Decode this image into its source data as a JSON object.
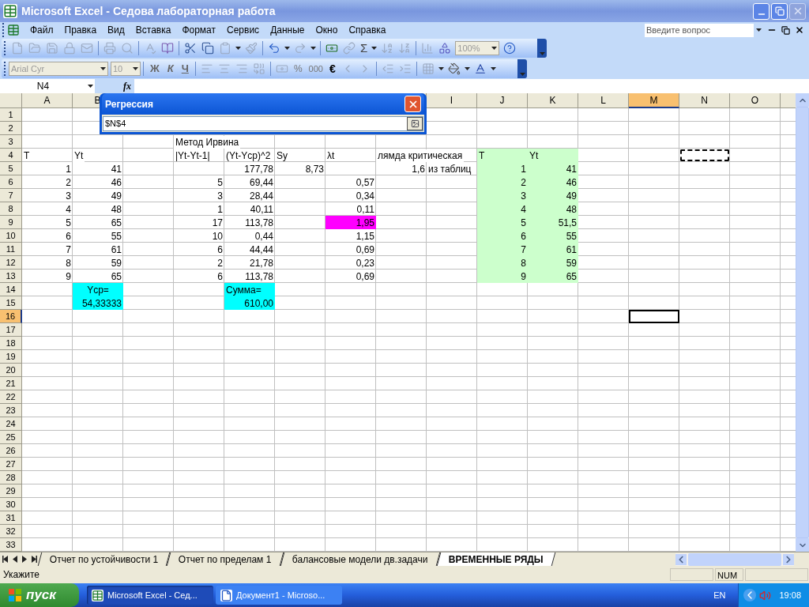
{
  "window": {
    "title": "Microsoft Excel - Седова лабораторная работа"
  },
  "menu": [
    "Файл",
    "Правка",
    "Вид",
    "Вставка",
    "Формат",
    "Сервис",
    "Данные",
    "Окно",
    "Справка"
  ],
  "help_search": {
    "placeholder": "Введите вопрос"
  },
  "standard_toolbar": {
    "sum": "Σ",
    "zoom": "100%"
  },
  "format_toolbar": {
    "font": "Arial Cyr",
    "size": "10",
    "bold": "Ж",
    "italic": "К",
    "underline": "Ч",
    "percent": "%",
    "thousands": "000",
    "euro": "€"
  },
  "formula_bar": {
    "name_box": "N4",
    "fx": "fx"
  },
  "dialog": {
    "title": "Регрессия",
    "value": "$N$4"
  },
  "column_headers": [
    {
      "label": "A",
      "selected": false
    },
    {
      "label": "B",
      "selected": false
    },
    {
      "label": "I",
      "selected": false
    },
    {
      "label": "J",
      "selected": false
    },
    {
      "label": "K",
      "selected": false
    },
    {
      "label": "L",
      "selected": false
    },
    {
      "label": "M",
      "selected": true
    },
    {
      "label": "N",
      "selected": false
    },
    {
      "label": "O",
      "selected": false
    }
  ],
  "rows": [
    {
      "header": "1",
      "selected": false
    },
    {
      "header": "2",
      "selected": false
    },
    {
      "header": "3",
      "selected": false,
      "cells": [
        null,
        null,
        null,
        {
          "text": "Метод Ирвина",
          "kind": "text",
          "selected": false
        }
      ]
    },
    {
      "header": "4",
      "selected": false,
      "cells": [
        {
          "text": "T",
          "kind": "text",
          "selected": false
        },
        {
          "text": "Yt",
          "kind": "text",
          "selected": false
        },
        null,
        {
          "text": "|Yt-Yt-1|",
          "kind": "text",
          "selected": false
        },
        {
          "text": "(Yt-Ycp)^2",
          "kind": "text",
          "selected": false
        },
        {
          "text": "Sy",
          "kind": "text",
          "selected": false
        },
        {
          "text": "λt",
          "kind": "text",
          "selected": false
        },
        {
          "text": "лямда критическая",
          "kind": "text",
          "selected": false
        },
        null,
        {
          "text": "T",
          "kind": "text",
          "selected": false,
          "color": "#ccffcc"
        },
        {
          "text": "Yt",
          "kind": "text",
          "selected": false,
          "color": "#ccffcc"
        },
        null,
        null,
        {
          "selected": false,
          "marquee": true
        }
      ]
    },
    {
      "header": "5",
      "selected": false,
      "cells": [
        {
          "text": "1",
          "kind": "number",
          "selected": false
        },
        {
          "text": "41",
          "kind": "number",
          "selected": false
        },
        null,
        null,
        {
          "text": "177,78",
          "kind": "number",
          "selected": false
        },
        {
          "text": "8,73",
          "kind": "number",
          "selected": false
        },
        null,
        {
          "text": "1,6",
          "kind": "number",
          "selected": false
        },
        {
          "text": "из таблиц",
          "kind": "text",
          "selected": false
        },
        {
          "text": "1",
          "kind": "number",
          "selected": false,
          "color": "#ccffcc"
        },
        {
          "text": "41",
          "kind": "number",
          "selected": false,
          "color": "#ccffcc"
        }
      ]
    },
    {
      "header": "6",
      "selected": false,
      "cells": [
        {
          "text": "2",
          "kind": "number",
          "selected": false
        },
        {
          "text": "46",
          "kind": "number",
          "selected": false
        },
        null,
        {
          "text": "5",
          "kind": "number",
          "selected": false
        },
        {
          "text": "69,44",
          "kind": "number",
          "selected": false
        },
        null,
        {
          "text": "0,57",
          "kind": "number",
          "selected": false
        },
        null,
        null,
        {
          "text": "2",
          "kind": "number",
          "selected": false,
          "color": "#ccffcc"
        },
        {
          "text": "46",
          "kind": "number",
          "selected": false,
          "color": "#ccffcc"
        }
      ]
    },
    {
      "header": "7",
      "selected": false,
      "cells": [
        {
          "text": "3",
          "kind": "number",
          "selected": false
        },
        {
          "text": "49",
          "kind": "number",
          "selected": false
        },
        null,
        {
          "text": "3",
          "kind": "number",
          "selected": false
        },
        {
          "text": "28,44",
          "kind": "number",
          "selected": false
        },
        null,
        {
          "text": "0,34",
          "kind": "number",
          "selected": false
        },
        null,
        null,
        {
          "text": "3",
          "kind": "number",
          "selected": false,
          "color": "#ccffcc"
        },
        {
          "text": "49",
          "kind": "number",
          "selected": false,
          "color": "#ccffcc"
        }
      ]
    },
    {
      "header": "8",
      "selected": false,
      "cells": [
        {
          "text": "4",
          "kind": "number",
          "selected": false
        },
        {
          "text": "48",
          "kind": "number",
          "selected": false
        },
        null,
        {
          "text": "1",
          "kind": "number",
          "selected": false
        },
        {
          "text": "40,11",
          "kind": "number",
          "selected": false
        },
        null,
        {
          "text": "0,11",
          "kind": "number",
          "selected": false
        },
        null,
        null,
        {
          "text": "4",
          "kind": "number",
          "selected": false,
          "color": "#ccffcc"
        },
        {
          "text": "48",
          "kind": "number",
          "selected": false,
          "color": "#ccffcc"
        }
      ]
    },
    {
      "header": "9",
      "selected": false,
      "cells": [
        {
          "text": "5",
          "kind": "number",
          "selected": false
        },
        {
          "text": "65",
          "kind": "number",
          "selected": false
        },
        null,
        {
          "text": "17",
          "kind": "number",
          "selected": false
        },
        {
          "text": "113,78",
          "kind": "number",
          "selected": false
        },
        null,
        {
          "text": "1,95",
          "kind": "number",
          "selected": false,
          "color": "#ff00ff"
        },
        null,
        null,
        {
          "text": "5",
          "kind": "number",
          "selected": false,
          "color": "#ccffcc"
        },
        {
          "text": "51,5",
          "kind": "number",
          "selected": false,
          "color": "#ccffcc"
        }
      ]
    },
    {
      "header": "10",
      "selected": false,
      "cells": [
        {
          "text": "6",
          "kind": "number",
          "selected": false
        },
        {
          "text": "55",
          "kind": "number",
          "selected": false
        },
        null,
        {
          "text": "10",
          "kind": "number",
          "selected": false
        },
        {
          "text": "0,44",
          "kind": "number",
          "selected": false
        },
        null,
        {
          "text": "1,15",
          "kind": "number",
          "selected": false
        },
        null,
        null,
        {
          "text": "6",
          "kind": "number",
          "selected": false,
          "color": "#ccffcc"
        },
        {
          "text": "55",
          "kind": "number",
          "selected": false,
          "color": "#ccffcc"
        }
      ]
    },
    {
      "header": "11",
      "selected": false,
      "cells": [
        {
          "text": "7",
          "kind": "number",
          "selected": false
        },
        {
          "text": "61",
          "kind": "number",
          "selected": false
        },
        null,
        {
          "text": "6",
          "kind": "number",
          "selected": false
        },
        {
          "text": "44,44",
          "kind": "number",
          "selected": false
        },
        null,
        {
          "text": "0,69",
          "kind": "number",
          "selected": false
        },
        null,
        null,
        {
          "text": "7",
          "kind": "number",
          "selected": false,
          "color": "#ccffcc"
        },
        {
          "text": "61",
          "kind": "number",
          "selected": false,
          "color": "#ccffcc"
        }
      ]
    },
    {
      "header": "12",
      "selected": false,
      "cells": [
        {
          "text": "8",
          "kind": "number",
          "selected": false
        },
        {
          "text": "59",
          "kind": "number",
          "selected": false
        },
        null,
        {
          "text": "2",
          "kind": "number",
          "selected": false
        },
        {
          "text": "21,78",
          "kind": "number",
          "selected": false
        },
        null,
        {
          "text": "0,23",
          "kind": "number",
          "selected": false
        },
        null,
        null,
        {
          "text": "8",
          "kind": "number",
          "selected": false,
          "color": "#ccffcc"
        },
        {
          "text": "59",
          "kind": "number",
          "selected": false,
          "color": "#ccffcc"
        }
      ]
    },
    {
      "header": "13",
      "selected": false,
      "cells": [
        {
          "text": "9",
          "kind": "number",
          "selected": false
        },
        {
          "text": "65",
          "kind": "number",
          "selected": false
        },
        null,
        {
          "text": "6",
          "kind": "number",
          "selected": false
        },
        {
          "text": "113,78",
          "kind": "number",
          "selected": false
        },
        null,
        {
          "text": "0,69",
          "kind": "number",
          "selected": false
        },
        null,
        null,
        {
          "text": "9",
          "kind": "number",
          "selected": false,
          "color": "#ccffcc"
        },
        {
          "text": "65",
          "kind": "number",
          "selected": false,
          "color": "#ccffcc"
        }
      ]
    },
    {
      "header": "14",
      "selected": false,
      "cells": [
        null,
        {
          "text": "Ycp=",
          "kind": "center",
          "selected": false,
          "color": "#00ffff"
        },
        null,
        null,
        {
          "text": "Сумма=",
          "kind": "text",
          "selected": false,
          "color": "#00ffff"
        }
      ]
    },
    {
      "header": "15",
      "selected": false,
      "cells": [
        null,
        {
          "text": "54,33333",
          "kind": "number",
          "selected": false,
          "color": "#00ffff"
        },
        null,
        null,
        {
          "text": "610,00",
          "kind": "number",
          "selected": false,
          "color": "#00ffff"
        }
      ]
    },
    {
      "header": "16",
      "selected": true,
      "cells": [
        null,
        null,
        null,
        null,
        null,
        null,
        null,
        null,
        null,
        null,
        null,
        null,
        {
          "selected": true
        }
      ]
    },
    {
      "header": "17",
      "selected": false
    },
    {
      "header": "18",
      "selected": false
    },
    {
      "header": "19",
      "selected": false
    },
    {
      "header": "20",
      "selected": false
    },
    {
      "header": "21",
      "selected": false
    },
    {
      "header": "22",
      "selected": false
    },
    {
      "header": "23",
      "selected": false
    },
    {
      "header": "24",
      "selected": false
    },
    {
      "header": "25",
      "selected": false
    },
    {
      "header": "26",
      "selected": false
    },
    {
      "header": "27",
      "selected": false
    },
    {
      "header": "28",
      "selected": false
    },
    {
      "header": "29",
      "selected": false
    },
    {
      "header": "30",
      "selected": false
    },
    {
      "header": "31",
      "selected": false
    },
    {
      "header": "32",
      "selected": false
    },
    {
      "header": "33",
      "selected": false
    }
  ],
  "sheet_tabs": [
    {
      "label": "Отчет по устойчивости 1",
      "selected": false
    },
    {
      "label": "Отчет по пределам 1",
      "selected": false
    },
    {
      "label": "балансовые модели дв.задачи",
      "selected": false
    },
    {
      "label": "ВРЕМЕННЫЕ РЯДЫ",
      "selected": true
    }
  ],
  "status_bar": {
    "text": "Укажите",
    "indicator": "NUM"
  },
  "taskbar": {
    "start": "пуск",
    "tasks": [
      {
        "label": "Microsoft Excel - Сед...",
        "selected": true
      },
      {
        "label": "Документ1 - Microso...",
        "selected": false
      }
    ],
    "language": "EN",
    "clock": "19:08"
  }
}
